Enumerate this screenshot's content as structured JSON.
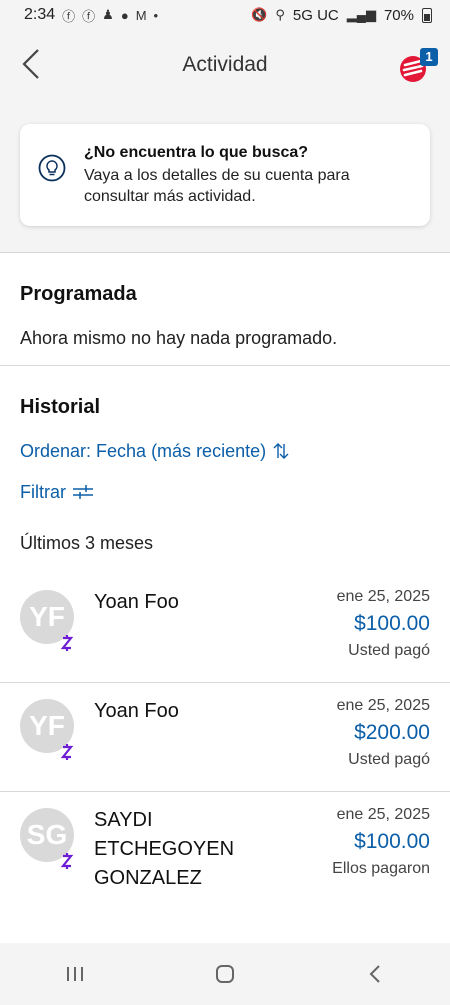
{
  "status_bar": {
    "time": "2:34",
    "dot": "•",
    "network": "5G UC",
    "battery": "70%",
    "icons": [
      "facebook-icon",
      "facebook-icon",
      "contacts-icon",
      "chat-icon",
      "gmail-icon"
    ]
  },
  "header": {
    "title": "Actividad",
    "notification_count": "1",
    "brand_color": "#e31837"
  },
  "info_card": {
    "title": "¿No encuentra lo que busca?",
    "body": "Vaya a los detalles de su cuenta para consultar más actividad."
  },
  "scheduled": {
    "heading": "Programada",
    "empty_text": "Ahora mismo no hay nada programado."
  },
  "history": {
    "heading": "Historial",
    "sort_label": "Ordenar: Fecha (más reciente)",
    "filter_label": "Filtrar",
    "period_label": "Últimos 3 meses",
    "transactions": [
      {
        "initials": "YF",
        "name": "Yoan Foo",
        "date": "ene 25, 2025",
        "amount": "$100.00",
        "direction": "Usted pagó"
      },
      {
        "initials": "YF",
        "name": "Yoan Foo",
        "date": "ene 25, 2025",
        "amount": "$200.00",
        "direction": "Usted pagó"
      },
      {
        "initials": "SG",
        "name": "SAYDI ETCHEGOYEN GONZALEZ",
        "date": "ene 25, 2025",
        "amount": "$100.00",
        "direction": "Ellos pagaron"
      }
    ]
  },
  "colors": {
    "accent": "#0b5ea8",
    "zelle_purple": "#6d1ed4",
    "avatar_bg": "#d9d9d9"
  }
}
